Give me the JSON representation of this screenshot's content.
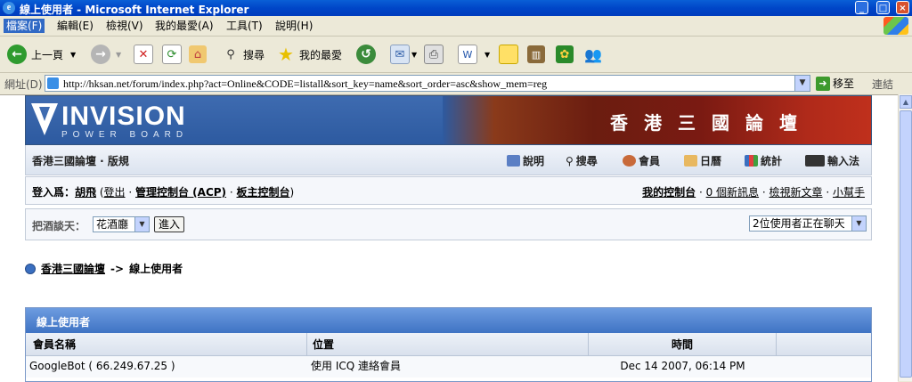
{
  "window": {
    "title": "線上使用者 - Microsoft Internet Explorer",
    "icon": "ie-icon"
  },
  "menubar": {
    "items": [
      "檔案(F)",
      "編輯(E)",
      "檢視(V)",
      "我的最愛(A)",
      "工具(T)",
      "說明(H)"
    ]
  },
  "toolbar": {
    "back_label": "上一頁",
    "search_label": "搜尋",
    "favorites_label": "我的最愛"
  },
  "address": {
    "label": "網址(D)",
    "url": "http://hksan.net/forum/index.php?act=Online&CODE=listall&sort_key=name&sort_order=asc&show_mem=reg",
    "go_label": "移至",
    "links_label": "連結"
  },
  "banner": {
    "logo_main": "INVISION",
    "logo_sub": "POWER BOARD",
    "chars": [
      "香",
      "港",
      "三",
      "國",
      "論",
      "壇"
    ]
  },
  "navbar": {
    "brand": "香港三國論壇 · 版規",
    "links": [
      "說明",
      "搜尋",
      "會員",
      "日曆",
      "統計",
      "輸入法"
    ]
  },
  "userbar": {
    "logged_in_prefix": "登入爲：",
    "username": "胡飛",
    "logout": "登出",
    "acp": "管理控制台 (ACP)",
    "mod_panel": "板主控制台",
    "my_controls": "我的控制台",
    "new_messages": "0 個新訊息",
    "view_new": "檢視新文章",
    "helper": "小幫手"
  },
  "chat": {
    "label": "把酒談天：",
    "room_selected": "花酒廳",
    "enter_button": "進入",
    "users_chatting": "2位使用者正在聊天"
  },
  "breadcrumb": {
    "home": "香港三國論壇",
    "separator": "->",
    "current": "線上使用者"
  },
  "online_table": {
    "title": "線上使用者",
    "columns": [
      "會員名稱",
      "位置",
      "時間",
      ""
    ],
    "rows": [
      {
        "member": "GoogleBot ( 66.249.67.25 )",
        "location": "使用 ICQ 連絡會員",
        "time": "Dec 14 2007, 06:14 PM",
        "extra": ""
      }
    ]
  }
}
